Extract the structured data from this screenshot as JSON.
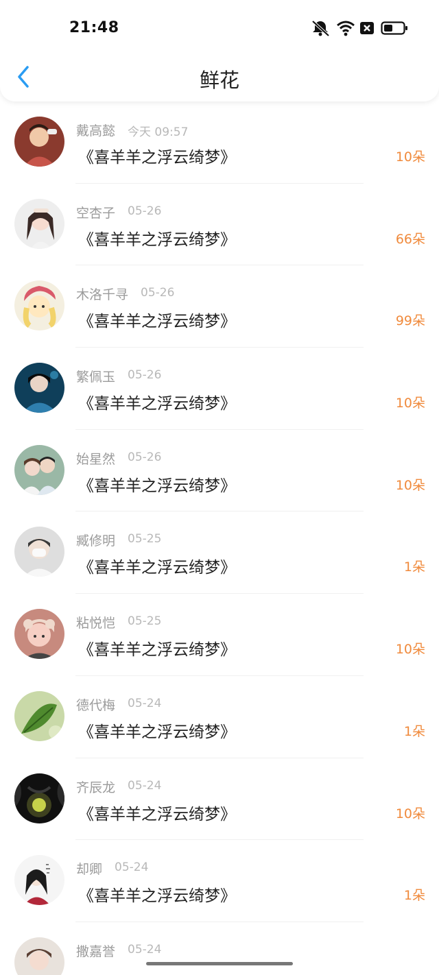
{
  "status_bar": {
    "time": "21:48",
    "icons": [
      "bell-muted-icon",
      "wifi-icon",
      "no-sim-icon",
      "battery-icon"
    ]
  },
  "header": {
    "title": "鲜花",
    "back_icon": "chevron-left-icon",
    "accent_color": "#2a9cf2"
  },
  "theme": {
    "count_color": "#f08a3c",
    "name_color": "#9b9b9b",
    "time_color": "#b8b8b8"
  },
  "list": [
    {
      "name": "戴高懿",
      "time": "今天 09:57",
      "book": "《喜羊羊之浮云绮梦》",
      "count": "10朵",
      "avatar": "avatar-photo-1"
    },
    {
      "name": "空杏子",
      "time": "05-26",
      "book": "《喜羊羊之浮云绮梦》",
      "count": "66朵",
      "avatar": "avatar-photo-2"
    },
    {
      "name": "木洛千寻",
      "time": "05-26",
      "book": "《喜羊羊之浮云绮梦》",
      "count": "99朵",
      "avatar": "avatar-photo-3"
    },
    {
      "name": "繁佩玉",
      "time": "05-26",
      "book": "《喜羊羊之浮云绮梦》",
      "count": "10朵",
      "avatar": "avatar-photo-4"
    },
    {
      "name": "始星然",
      "time": "05-26",
      "book": "《喜羊羊之浮云绮梦》",
      "count": "10朵",
      "avatar": "avatar-photo-5"
    },
    {
      "name": "臧修明",
      "time": "05-25",
      "book": "《喜羊羊之浮云绮梦》",
      "count": "1朵",
      "avatar": "avatar-photo-6"
    },
    {
      "name": "粘悦恺",
      "time": "05-25",
      "book": "《喜羊羊之浮云绮梦》",
      "count": "10朵",
      "avatar": "avatar-photo-7"
    },
    {
      "name": "德代梅",
      "time": "05-24",
      "book": "《喜羊羊之浮云绮梦》",
      "count": "1朵",
      "avatar": "avatar-photo-8"
    },
    {
      "name": "齐辰龙",
      "time": "05-24",
      "book": "《喜羊羊之浮云绮梦》",
      "count": "10朵",
      "avatar": "avatar-photo-9"
    },
    {
      "name": "却卿",
      "time": "05-24",
      "book": "《喜羊羊之浮云绮梦》",
      "count": "1朵",
      "avatar": "avatar-photo-10"
    },
    {
      "name": "撒嘉誉",
      "time": "05-24",
      "book": "",
      "count": "",
      "avatar": "avatar-photo-11"
    }
  ]
}
